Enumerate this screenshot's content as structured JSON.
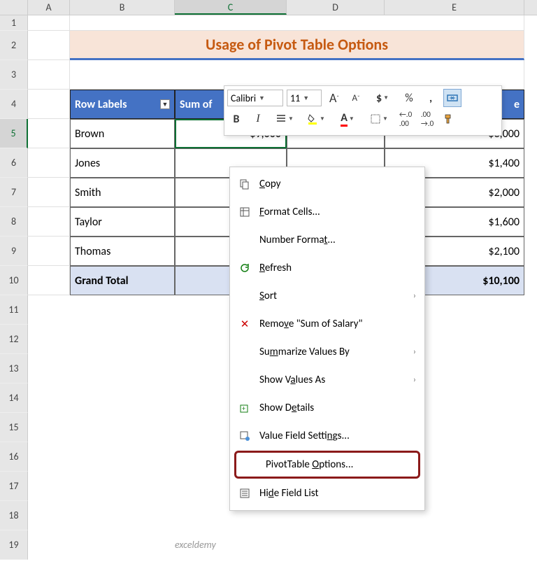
{
  "columns": [
    "A",
    "B",
    "C",
    "D",
    "E"
  ],
  "rows": [
    "1",
    "2",
    "3",
    "4",
    "5",
    "6",
    "7",
    "8",
    "9",
    "10",
    "11",
    "12",
    "13",
    "14",
    "15",
    "16",
    "17",
    "18",
    "19"
  ],
  "title": "Usage of Pivot Table Options",
  "headers": {
    "row_labels": "Row Labels",
    "sum_of": "Sum of"
  },
  "data": {
    "rows": [
      {
        "name": "Brown",
        "c": "$9,000",
        "e": "$3,000"
      },
      {
        "name": "Jones",
        "c": "",
        "e": "$1,400"
      },
      {
        "name": "Smith",
        "c": "",
        "e": "$2,000"
      },
      {
        "name": "Taylor",
        "c": "",
        "e": "$1,600"
      },
      {
        "name": "Thomas",
        "c": "",
        "e": "$2,100"
      }
    ],
    "grand_total": {
      "label": "Grand Total",
      "c_prefix": "$",
      "e": "$10,100"
    }
  },
  "mini_toolbar": {
    "font_name": "Calibri",
    "font_size": "11",
    "increase_font_title": "Increase Font Size",
    "decrease_font_title": "Decrease Font Size"
  },
  "context_menu": {
    "copy": "Copy",
    "format_cells": "Format Cells...",
    "number_format": "Number Format...",
    "refresh": "Refresh",
    "sort": "Sort",
    "remove": "Remove \"Sum of Salary\"",
    "summarize": "Summarize Values By",
    "show_values": "Show Values As",
    "show_details": "Show Details",
    "value_field": "Value Field Settings...",
    "pivot_options": "PivotTable Options...",
    "hide_list": "Hide Field List"
  },
  "watermark": "exceldemy"
}
